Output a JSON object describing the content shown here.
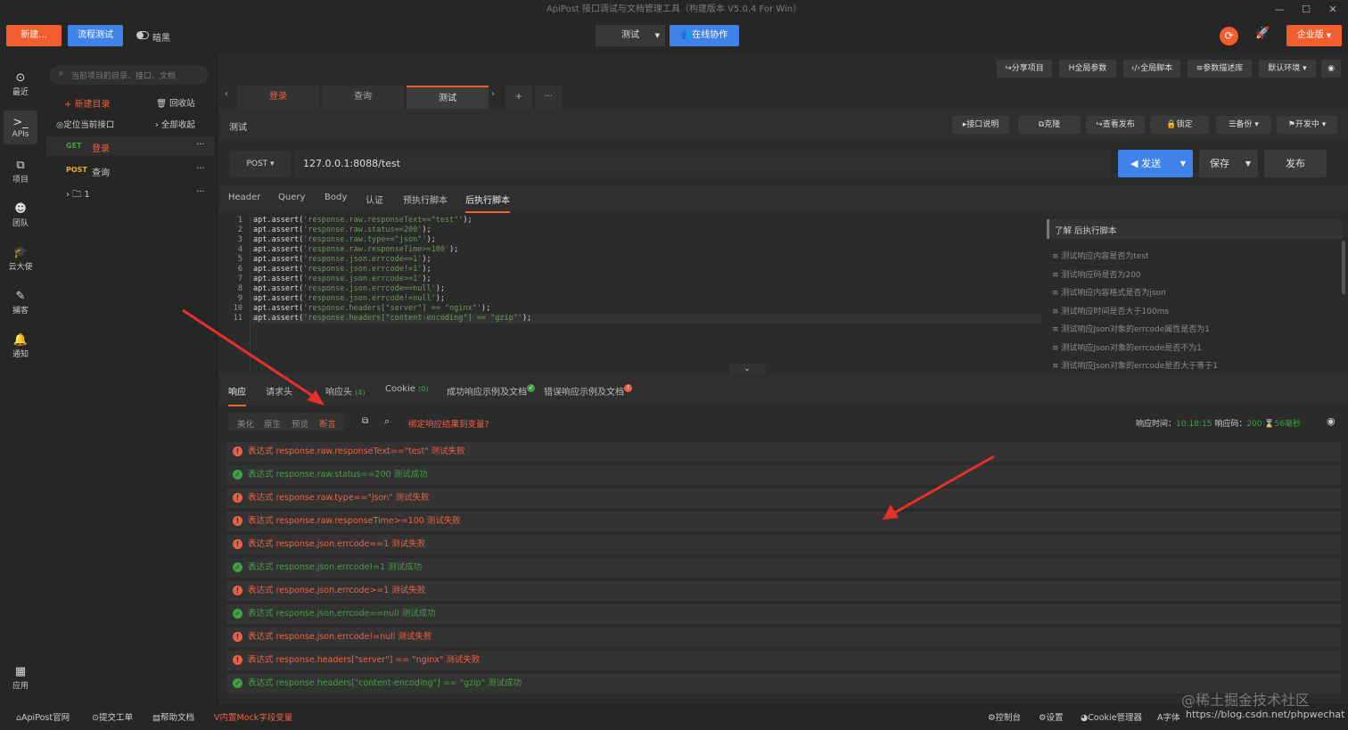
{
  "window": {
    "title": "ApiPost 接口调试与文档管理工具（构建版本 V5.0.4 For Win）",
    "min": "—",
    "max": "☐",
    "close": "✕"
  },
  "topbar": {
    "new_label": "新建...",
    "flow_label": "流程测试",
    "dark_label": "暗黑",
    "env_label": "测试",
    "collab_label": "在线协作",
    "enterprise_label": "企业版"
  },
  "leftnav": [
    {
      "label": "最近",
      "icon": "⊙"
    },
    {
      "label": "APIs",
      "icon": ">_"
    },
    {
      "label": "项目",
      "icon": "⧉"
    },
    {
      "label": "团队",
      "icon": "☻"
    },
    {
      "label": "云大使",
      "icon": "🎓"
    },
    {
      "label": "捕客",
      "icon": "✎"
    },
    {
      "label": "通知",
      "icon": "🔔"
    },
    {
      "label": "应用",
      "icon": "▦"
    }
  ],
  "tree": {
    "search_placeholder": "当前项目的目录、接口、文档",
    "new_dir": "新建目录",
    "recycle": "回收站",
    "locate": "定位当前接口",
    "collapse": "全部收起",
    "items": [
      {
        "method": "GET",
        "name": "登录"
      },
      {
        "method": "POST",
        "name": "查询"
      },
      {
        "method": "",
        "name": "1"
      }
    ]
  },
  "header_buttons": [
    "分享项目",
    "全局参数",
    "全局脚本",
    "参数描述库",
    "默认环境"
  ],
  "tabs": [
    "登录",
    "查询",
    "测试"
  ],
  "tab_add": "+",
  "tab_more": "···",
  "api": {
    "name": "测试",
    "actions": [
      "接口说明",
      "克隆",
      "查看发布",
      "锁定",
      "备份",
      "开发中"
    ],
    "method": "POST",
    "url": "127.0.0.1:8088/test",
    "send": "发送",
    "save": "保存",
    "publish": "发布"
  },
  "subtabs": [
    "Header",
    "Query",
    "Body",
    "认证",
    "预执行脚本",
    "后执行脚本"
  ],
  "code_lines": [
    {
      "n": "1",
      "pre": "apt.assert(",
      "str": "'response.raw.responseText==\"test\"'",
      "post": ");"
    },
    {
      "n": "2",
      "pre": "apt.assert(",
      "str": "'response.raw.status==200'",
      "post": ");"
    },
    {
      "n": "3",
      "pre": "apt.assert(",
      "str": "'response.raw.type==\"json\"'",
      "post": ");"
    },
    {
      "n": "4",
      "pre": "apt.assert(",
      "str": "'response.raw.responseTime>=100'",
      "post": ");"
    },
    {
      "n": "5",
      "pre": "apt.assert(",
      "str": "'response.json.errcode==1'",
      "post": ");"
    },
    {
      "n": "6",
      "pre": "apt.assert(",
      "str": "'response.json.errcode!=1'",
      "post": ");"
    },
    {
      "n": "7",
      "pre": "apt.assert(",
      "str": "'response.json.errcode>=1'",
      "post": ");"
    },
    {
      "n": "8",
      "pre": "apt.assert(",
      "str": "'response.json.errcode==null'",
      "post": ");"
    },
    {
      "n": "9",
      "pre": "apt.assert(",
      "str": "'response.json.errcode!=null'",
      "post": ");"
    },
    {
      "n": "10",
      "pre": "apt.assert(",
      "str": "'response.headers[\"server\"] == \"nginx\"'",
      "post": ");"
    },
    {
      "n": "11",
      "pre": "apt.assert(",
      "str": "'response.headers[\"content-encoding\"] == \"gzip\"'",
      "post": ");"
    }
  ],
  "tips": {
    "header": "了解 后执行脚本",
    "items": [
      "测试响应内容是否为test",
      "测试响应码是否为200",
      "测试响应内容格式是否为json",
      "测试响应时间是否大于100ms",
      "测试响应Json对象的errcode属性是否为1",
      "测试响应Json对象的errcode是否不为1",
      "测试响应Json对象的errcode是否大于等于1"
    ]
  },
  "response_tabs": [
    {
      "label": "响应",
      "count": ""
    },
    {
      "label": "请求头",
      "count": ""
    },
    {
      "label": "响应头",
      "count": "(4)"
    },
    {
      "label": "Cookie",
      "count": "(0)"
    },
    {
      "label": "成功响应示例及文档",
      "count": ""
    },
    {
      "label": "错误响应示例及文档",
      "count": ""
    }
  ],
  "view_modes": [
    "美化",
    "原生",
    "预览",
    "断言"
  ],
  "bind_var": "绑定响应结果到变量?",
  "resp_meta": {
    "time_label": "响应时间：",
    "time": "10:18:15",
    "code_label": "响应码：",
    "code": "200",
    "duration": "56毫秒"
  },
  "results": [
    {
      "ok": false,
      "text": "表达式 response.raw.responseText==\"test\" 测试失败"
    },
    {
      "ok": true,
      "text": "表达式 response.raw.status==200 测试成功"
    },
    {
      "ok": false,
      "text": "表达式 response.raw.type==\"json\" 测试失败"
    },
    {
      "ok": false,
      "text": "表达式 response.raw.responseTime>=100 测试失败"
    },
    {
      "ok": false,
      "text": "表达式 response.json.errcode==1 测试失败"
    },
    {
      "ok": true,
      "text": "表达式 response.json.errcode!=1 测试成功"
    },
    {
      "ok": false,
      "text": "表达式 response.json.errcode>=1 测试失败"
    },
    {
      "ok": true,
      "text": "表达式 response.json.errcode==null 测试成功"
    },
    {
      "ok": false,
      "text": "表达式 response.json.errcode!=null 测试失败"
    },
    {
      "ok": false,
      "text": "表达式 response.headers[\"server\"] == \"nginx\" 测试失败"
    },
    {
      "ok": true,
      "text": "表达式 response.headers[\"content-encoding\"] == \"gzip\" 测试成功"
    }
  ],
  "statusbar": {
    "left": [
      "ApiPost官网",
      "提交工单",
      "帮助文档",
      "内置Mock字段变量"
    ],
    "right": [
      "控制台",
      "设置",
      "Cookie管理器",
      "字体"
    ],
    "watermark": "@稀土掘金技术社区",
    "url_watermark": "https://blog.csdn.net/phpwechat"
  },
  "colors": {
    "accent": "#f15d2f",
    "blue": "#3f82e8",
    "fail": "#f06040",
    "ok": "#3fa040"
  }
}
